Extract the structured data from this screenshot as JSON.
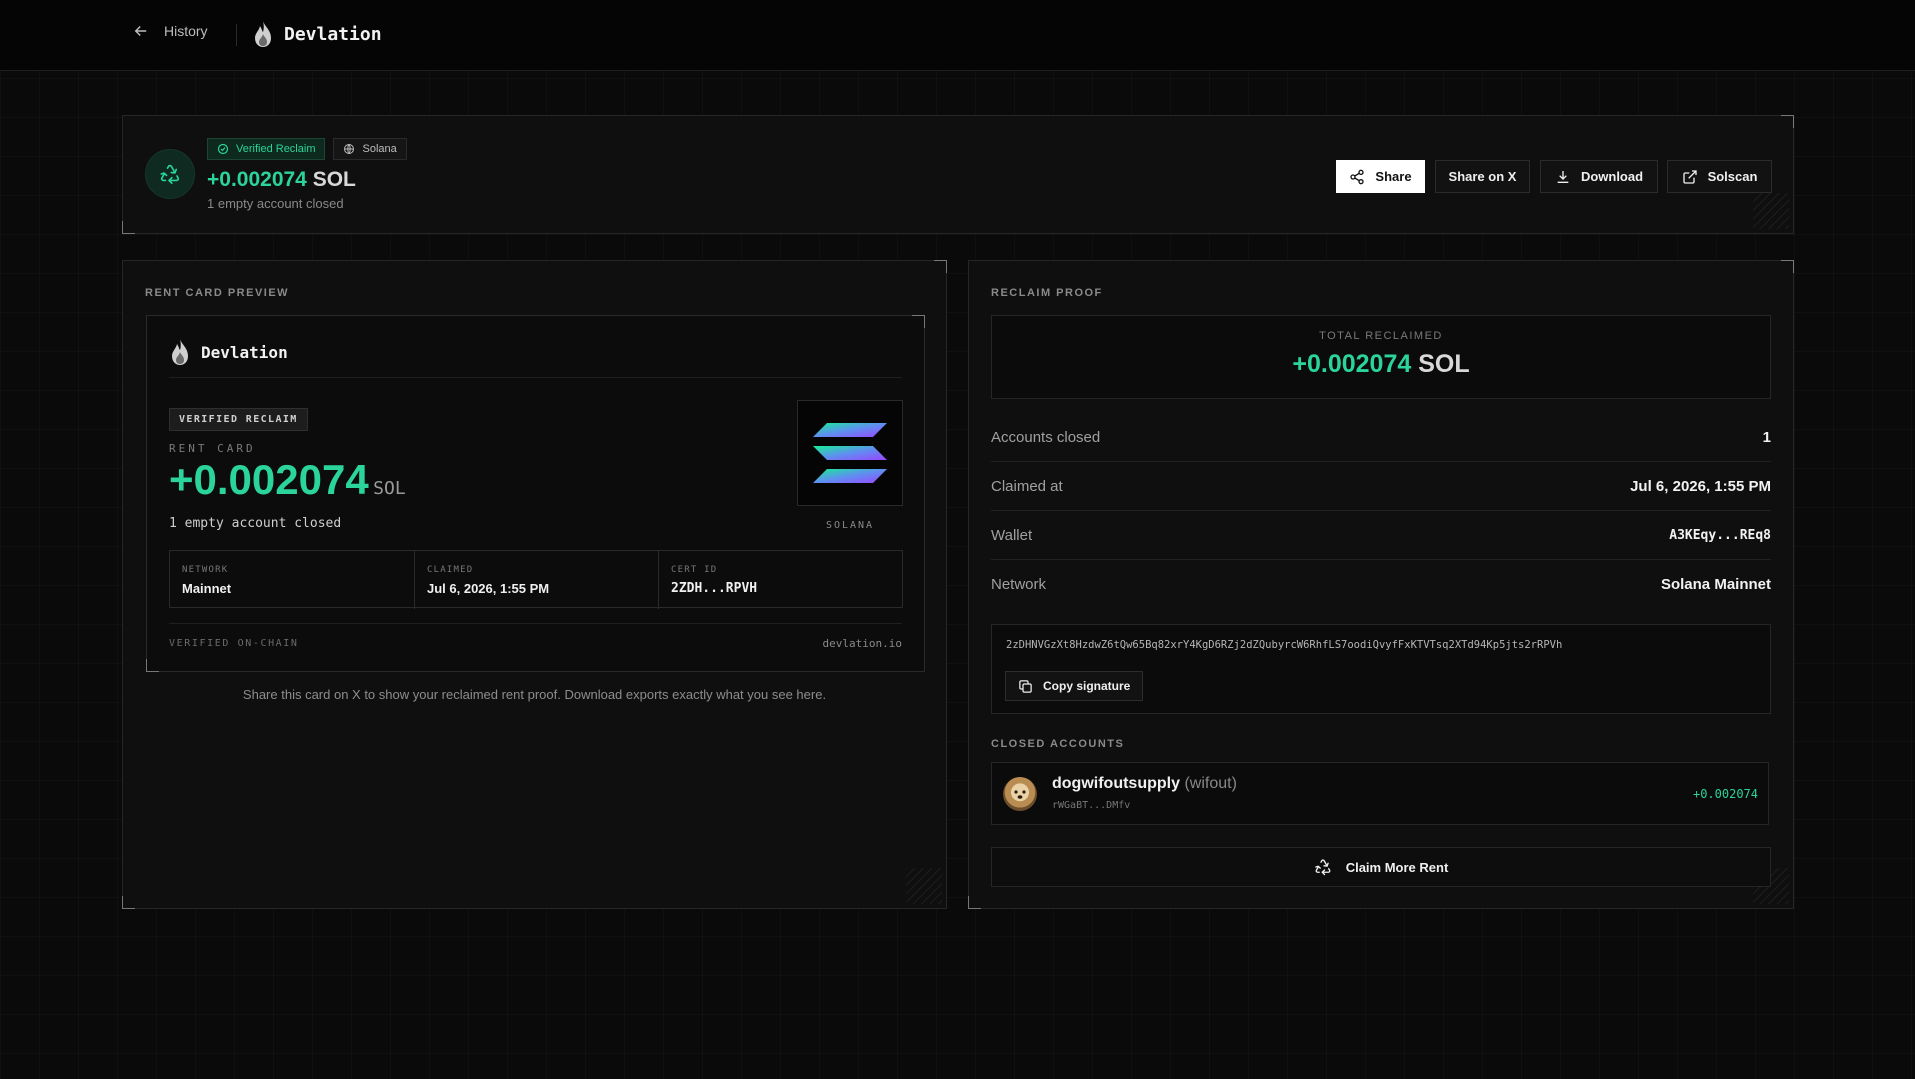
{
  "topbar": {
    "back_label": "History",
    "brand": "Devlation"
  },
  "header": {
    "badge_verified": "Verified Reclaim",
    "badge_network": "Solana",
    "amount": "+0.002074",
    "unit": "SOL",
    "subtitle": "1 empty account closed",
    "buttons": {
      "share": "Share",
      "share_x": "Share on X",
      "download": "Download",
      "solscan": "Solscan"
    }
  },
  "preview": {
    "section_label": "RENT CARD PREVIEW",
    "card": {
      "brand": "Devlation",
      "badge": "VERIFIED RECLAIM",
      "label": "RENT CARD",
      "amount": "+0.002074",
      "unit": "SOL",
      "subtitle": "1 empty account closed",
      "logo_caption": "SOLANA",
      "cells": [
        {
          "key": "NETWORK",
          "value": "Mainnet"
        },
        {
          "key": "CLAIMED",
          "value": "Jul 6, 2026, 1:55 PM"
        },
        {
          "key": "CERT ID",
          "value": "2ZDH...RPVH"
        }
      ],
      "footer_left": "VERIFIED ON-CHAIN",
      "footer_right": "devlation.io"
    },
    "caption": "Share this card on X to show your reclaimed rent proof. Download exports exactly what you see here."
  },
  "proof": {
    "section_label": "RECLAIM PROOF",
    "total_label": "TOTAL RECLAIMED",
    "total_amount": "+0.002074",
    "total_unit": "SOL",
    "rows": [
      {
        "key": "Accounts closed",
        "value": "1"
      },
      {
        "key": "Claimed at",
        "value": "Jul 6, 2026, 1:55 PM"
      },
      {
        "key": "Wallet",
        "value": "A3KEqy...REq8"
      },
      {
        "key": "Network",
        "value": "Solana Mainnet"
      }
    ],
    "signature": "2zDHNVGzXt8HzdwZ6tQw65Bq82xrY4KgD6RZj2dZQubyrcW6RhfLS7oodiQvyfFxKTVTsq2XTd94Kp5jts2rRPVh",
    "copy_label": "Copy signature",
    "closed_label": "CLOSED ACCOUNTS",
    "closed_accounts": [
      {
        "name": "dogwifoutsupply",
        "symbol": "(wifout)",
        "address": "rWGaBT...DMfv",
        "amount": "+0.002074"
      }
    ],
    "claim_more": "Claim More Rent"
  },
  "colors": {
    "accent": "#2bd49a",
    "background": "#0a0a0a",
    "panel": "#0f0f0f"
  }
}
